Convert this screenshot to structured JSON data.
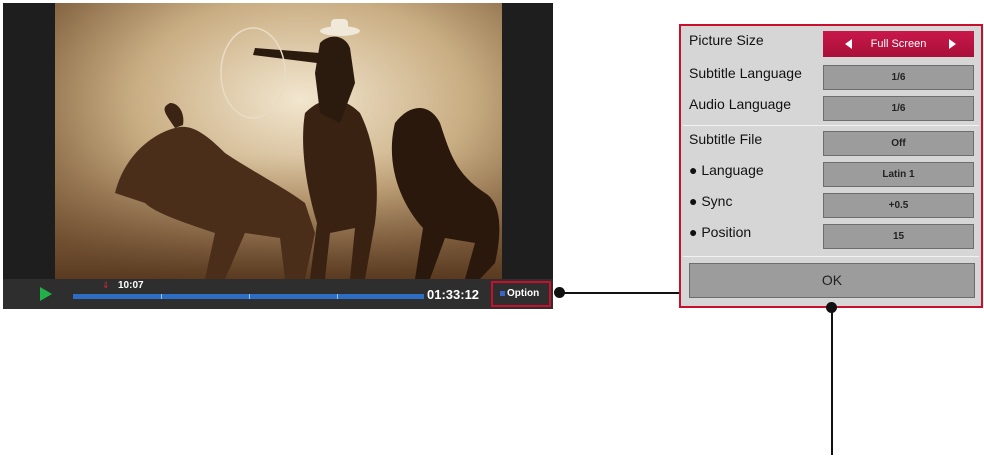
{
  "player": {
    "current_time": "10:07",
    "total_time": "01:33:12",
    "option_label": "Option",
    "marker_glyph": "⇓",
    "progress_fraction": 0.15
  },
  "panel": {
    "rows": [
      {
        "label": "Picture Size",
        "value": "Full Screen"
      },
      {
        "label": "Subtitle Language",
        "value": "1/6"
      },
      {
        "label": "Audio Language",
        "value": "1/6"
      },
      {
        "label": "Subtitle File",
        "value": "Off"
      },
      {
        "label": "● Language",
        "value": "Latin 1"
      },
      {
        "label": "● Sync",
        "value": "+0.5"
      },
      {
        "label": "● Position",
        "value": "15"
      }
    ],
    "ok_label": "OK"
  },
  "colors": {
    "accent": "#c8102e",
    "progress": "#2d6ec4",
    "play": "#22b04a"
  }
}
